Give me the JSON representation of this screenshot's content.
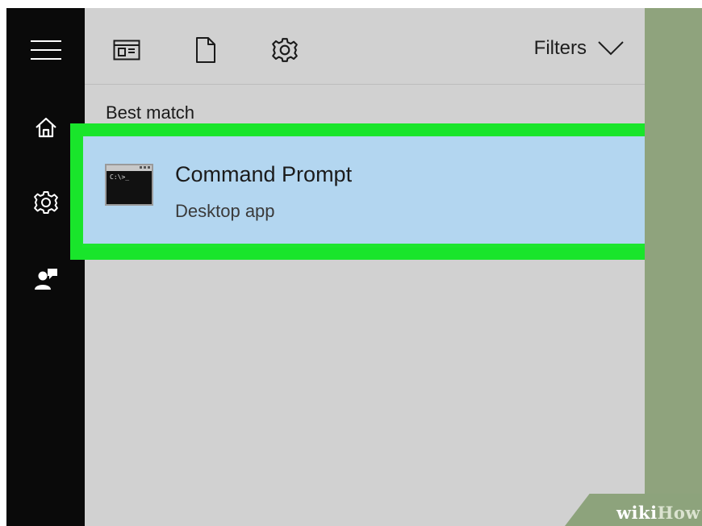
{
  "rail": {
    "items": [
      {
        "name": "menu",
        "icon": "hamburger-menu-icon"
      },
      {
        "name": "home",
        "icon": "home-icon"
      },
      {
        "name": "settings",
        "icon": "gear-icon"
      },
      {
        "name": "feedback",
        "icon": "feedback-person-icon"
      }
    ]
  },
  "toolbar": {
    "icons": [
      "apps-icon",
      "document-icon",
      "settings-gear-icon"
    ],
    "filters_label": "Filters"
  },
  "results": {
    "section_label": "Best match",
    "best_match": {
      "title": "Command Prompt",
      "subtitle": "Desktop app",
      "icon": "command-prompt-icon",
      "icon_text": "C:\\>_"
    }
  },
  "watermark": {
    "part1": "wiki",
    "part2": "How"
  },
  "colors": {
    "rail": "#0a0a0a",
    "panel": "#d1d1d1",
    "selection": "#b3d6f0",
    "highlight": "#1ee530",
    "desktop": "#8fa37d"
  }
}
